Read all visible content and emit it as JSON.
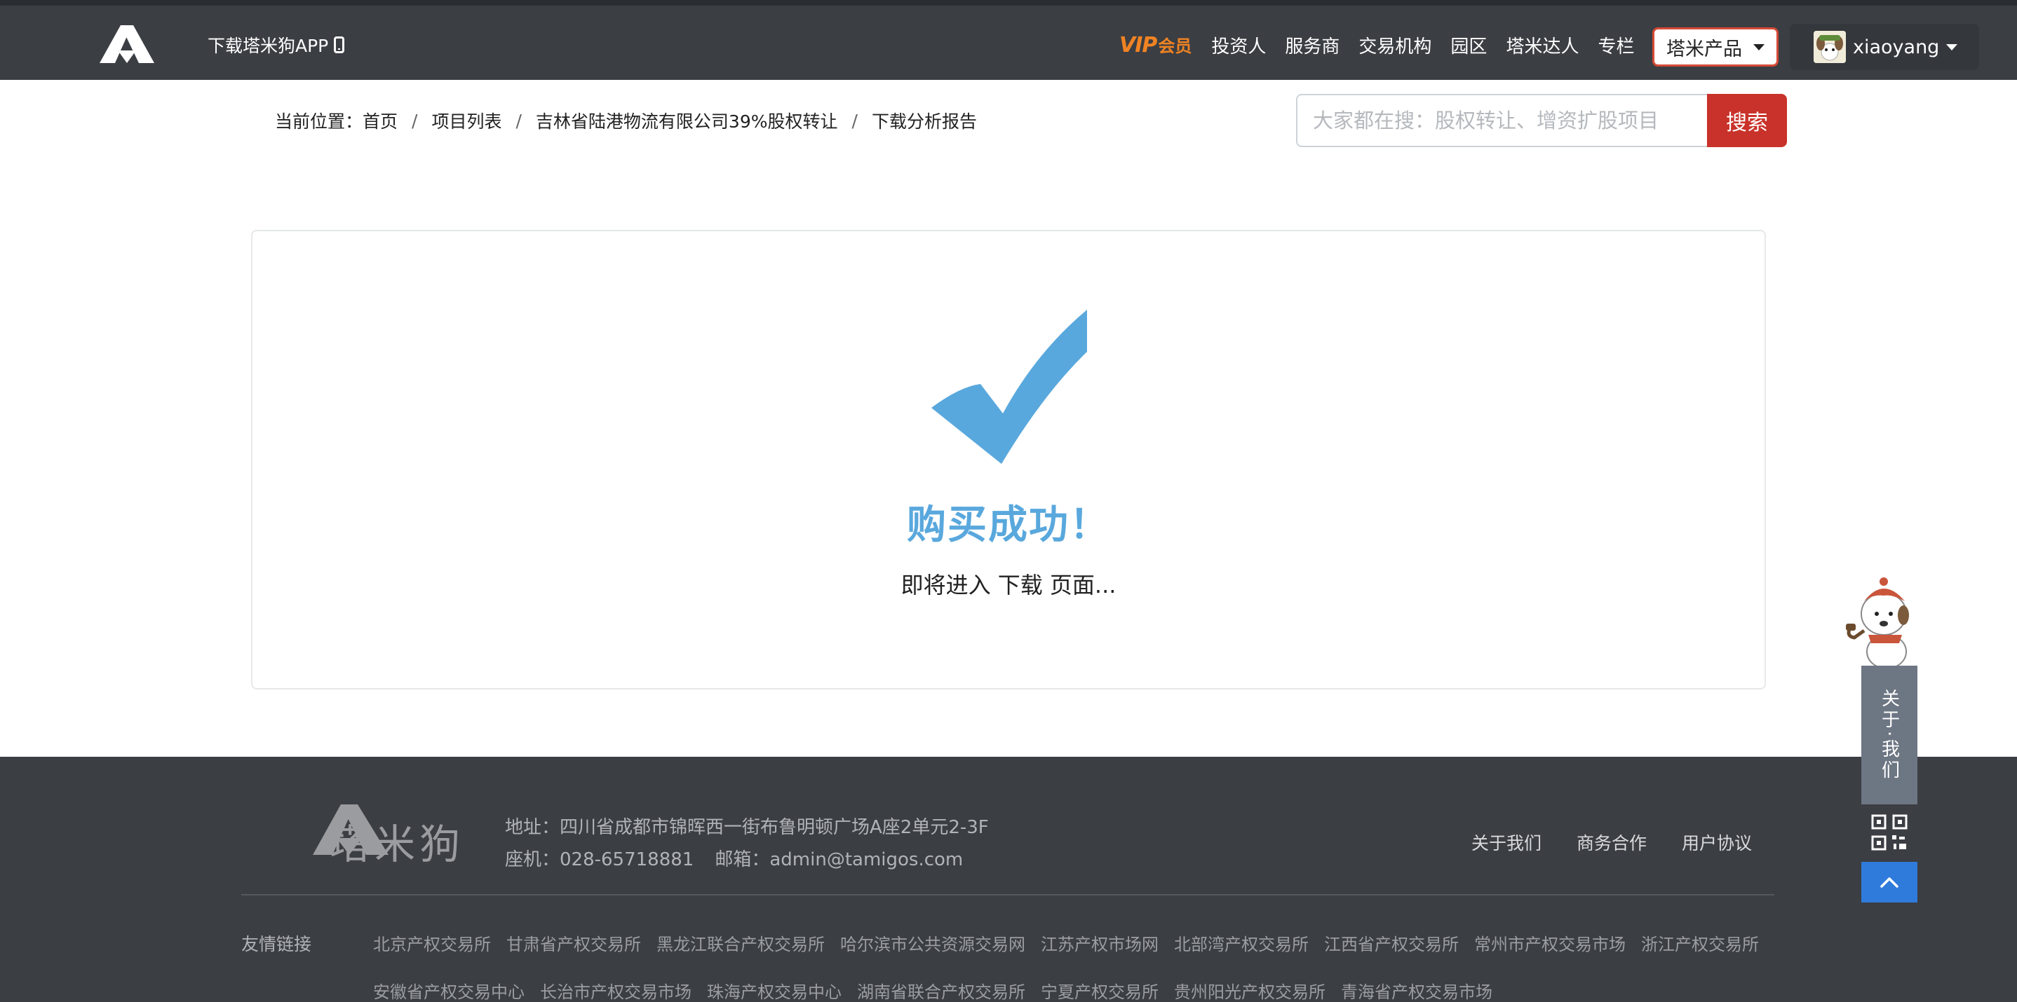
{
  "navbar": {
    "app_download": "下载塔米狗APP",
    "vip_big": "VIP",
    "vip_small": "会员",
    "links": [
      "投资人",
      "服务商",
      "交易机构",
      "园区",
      "塔米达人",
      "专栏"
    ],
    "product_menu": "塔米产品",
    "username": "xiaoyang"
  },
  "breadcrumb": {
    "prefix": "当前位置：",
    "items": [
      "首页",
      "项目列表",
      "吉林省陆港物流有限公司39%股权转让",
      "下载分析报告"
    ],
    "separator": "/"
  },
  "search": {
    "placeholder": "大家都在搜：股权转让、增资扩股项目",
    "button": "搜索"
  },
  "result": {
    "title": "购买成功！",
    "subtitle": "即将进入 下载 页面..."
  },
  "footer": {
    "brand": "塔米狗",
    "address": "地址：四川省成都市锦晖西一街布鲁明顿广场A座2单元2-3F",
    "phone": "座机：028-65718881",
    "email": "邮箱：admin@tamigos.com",
    "links": [
      "关于我们",
      "商务合作",
      "用户协议"
    ],
    "friend_label": "友情链接",
    "friend_links_row1": [
      "北京产权交易所",
      "甘肃省产权交易所",
      "黑龙江联合产权交易所",
      "哈尔滨市公共资源交易网",
      "江苏产权市场网",
      "北部湾产权交易所",
      "江西省产权交易所",
      "常州市产权交易市场",
      "浙江产权交易所"
    ],
    "friend_links_row2": [
      "安徽省产权交易中心",
      "长治市产权交易市场",
      "珠海产权交易中心",
      "湖南省联合产权交易所",
      "宁夏产权交易所",
      "贵州阳光产权交易所",
      "青海省产权交易市场"
    ]
  },
  "widget": {
    "about": "关于·我们"
  },
  "colors": {
    "navbar_bg": "#3b3e43",
    "vip": "#f08323",
    "search_button": "#c9322a",
    "success": "#59a8dd",
    "back_to_top": "#2f7bdb"
  }
}
